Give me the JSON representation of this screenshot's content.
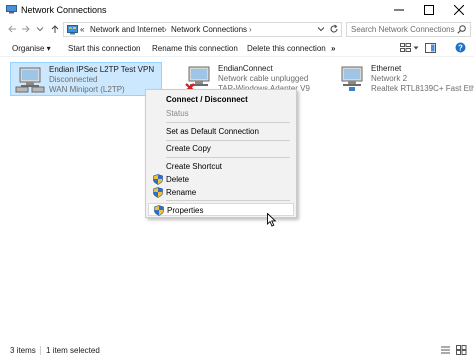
{
  "window": {
    "title": "Network Connections",
    "minimize_glyph": "—",
    "maximize_glyph": "☐",
    "close_glyph": "✕"
  },
  "address": {
    "overflow_label": "«",
    "crumbs": [
      "Network and Internet",
      "Network Connections"
    ],
    "crumb_separator": "›",
    "search_placeholder": "Search Network Connections"
  },
  "toolbar": {
    "organise_label": "Organise ▾",
    "start_label": "Start this connection",
    "rename_label": "Rename this connection",
    "delete_label": "Delete this connection",
    "more_label": "»"
  },
  "connections": [
    {
      "name": "Endian IPSec L2TP Test VPN",
      "status": "Disconnected",
      "device": "WAN Miniport (L2TP)",
      "selected": true,
      "icon": "vpn-connection-icon"
    },
    {
      "name": "EndianConnect",
      "status": "Network cable unplugged",
      "device": "TAP-Windows Adapter V9",
      "selected": false,
      "icon": "ethernet-unplugged-icon"
    },
    {
      "name": "Ethernet",
      "status": "Network 2",
      "device": "Realtek RTL8139C+ Fast Eth...",
      "selected": false,
      "icon": "ethernet-connected-icon"
    }
  ],
  "context_menu": {
    "items": [
      {
        "label": "Connect / Disconnect",
        "bold": true,
        "disabled": false,
        "shield": false
      },
      {
        "label": "Status",
        "bold": false,
        "disabled": true,
        "shield": false
      },
      {
        "label": "Set as Default Connection",
        "bold": false,
        "disabled": false,
        "shield": false
      },
      {
        "label": "Create Copy",
        "bold": false,
        "disabled": false,
        "shield": false
      },
      {
        "label": "Create Shortcut",
        "bold": false,
        "disabled": false,
        "shield": false
      },
      {
        "label": "Delete",
        "bold": false,
        "disabled": false,
        "shield": true
      },
      {
        "label": "Rename",
        "bold": false,
        "disabled": false,
        "shield": true
      },
      {
        "label": "Properties",
        "bold": false,
        "disabled": false,
        "shield": true,
        "hovered": true
      }
    ]
  },
  "statusbar": {
    "count": "3 items",
    "selection": "1 item selected"
  },
  "colors": {
    "selection_bg": "#cce8ff",
    "selection_border": "#99d1ff",
    "menu_bg": "#f2f2f2"
  }
}
